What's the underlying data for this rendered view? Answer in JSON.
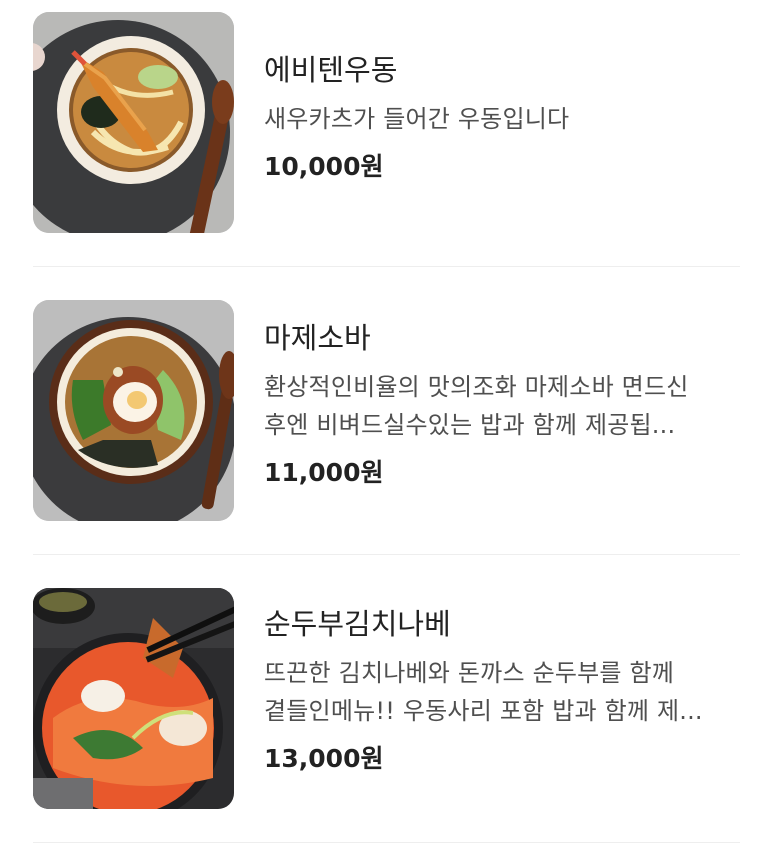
{
  "currency_suffix": "원",
  "menu": [
    {
      "name": "에비텐우동",
      "description_lines": [
        "새우카츠가 들어간 우동입니다"
      ],
      "price": "10,000원",
      "image": "ebiten-udon-photo"
    },
    {
      "name": "마제소바",
      "description_lines": [
        "환상적인비율의 맛의조화 마제소바 면드신",
        "후엔 비벼드실수있는 밥과 함께 제공됩..."
      ],
      "price": "11,000원",
      "image": "mazesoba-photo"
    },
    {
      "name": "순두부김치나베",
      "description_lines": [
        "뜨끈한 김치나베와 돈까스 순두부를 함께",
        "곁들인메뉴!! 우동사리 포함 밥과 함께 제..."
      ],
      "price": "13,000원",
      "image": "sundubu-kimchi-nabe-photo"
    }
  ]
}
